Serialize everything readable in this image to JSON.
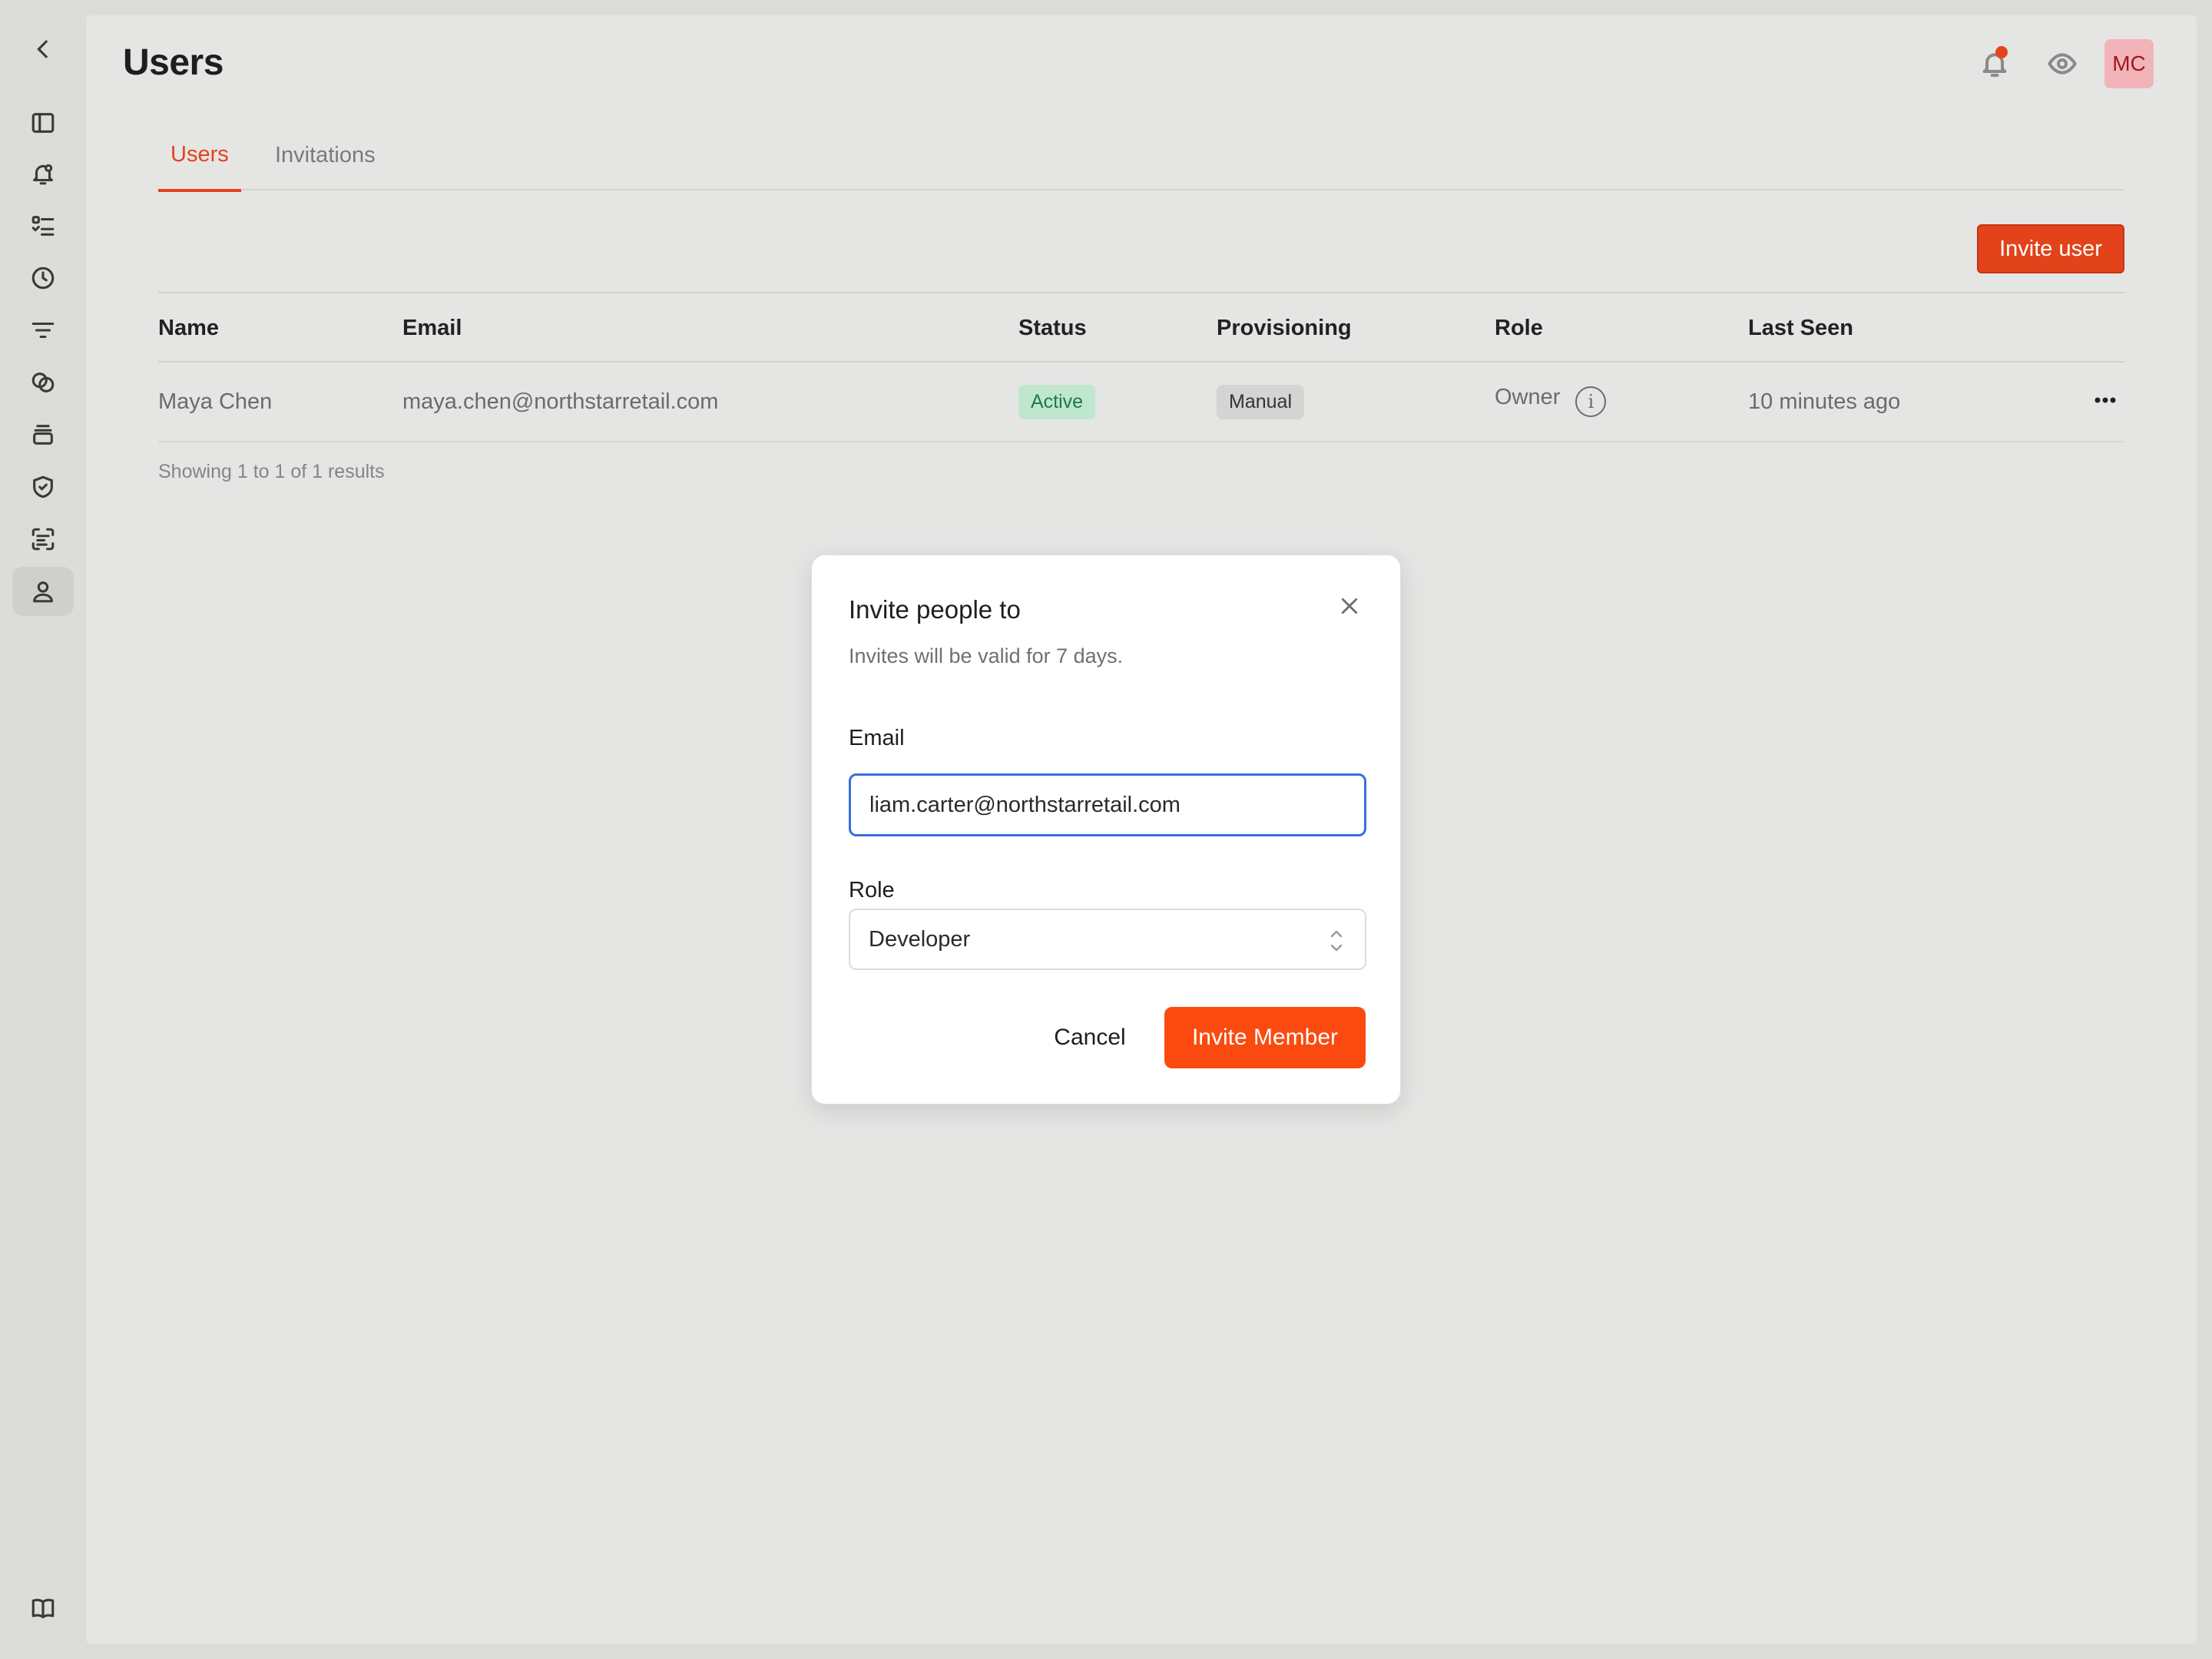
{
  "sidebar": {
    "items": [
      {
        "icon": "chevron-left-icon"
      },
      {
        "icon": "sidebar-toggle-icon"
      },
      {
        "icon": "alert-bell-icon"
      },
      {
        "icon": "checklist-icon"
      },
      {
        "icon": "clock-icon"
      },
      {
        "icon": "filter-icon"
      },
      {
        "icon": "integrations-icon"
      },
      {
        "icon": "stack-icon"
      },
      {
        "icon": "shield-icon"
      },
      {
        "icon": "scan-icon"
      },
      {
        "icon": "user-icon"
      },
      {
        "icon": "book-icon"
      }
    ]
  },
  "header": {
    "title": "Users",
    "notification_icon": "bell-icon",
    "preview_icon": "eye-icon",
    "avatar_initials": "MC"
  },
  "tabs": [
    {
      "label": "Users",
      "active": true
    },
    {
      "label": "Invitations",
      "active": false
    }
  ],
  "actions": {
    "invite_user_label": "Invite user"
  },
  "table": {
    "columns": [
      "Name",
      "Email",
      "Status",
      "Provisioning",
      "Role",
      "Last Seen"
    ],
    "rows": [
      {
        "name": "Maya Chen",
        "email": "maya.chen@northstarretail.com",
        "status": "Active",
        "provisioning": "Manual",
        "role": "Owner",
        "last_seen": "10 minutes ago"
      }
    ],
    "results_text": "Showing 1 to 1 of 1 results"
  },
  "modal": {
    "title": "Invite people to",
    "subtitle": "Invites will be valid for 7 days.",
    "email_label": "Email",
    "email_value": "liam.carter@northstarretail.com",
    "role_label": "Role",
    "role_value": "Developer",
    "cancel_label": "Cancel",
    "submit_label": "Invite Member"
  },
  "colors": {
    "accent": "#e2431a",
    "primary_button": "#fb4a0f",
    "focus_ring": "#3a6fd8",
    "status_active_bg": "#bfe6cf",
    "avatar_bg": "#f2b4b8"
  }
}
